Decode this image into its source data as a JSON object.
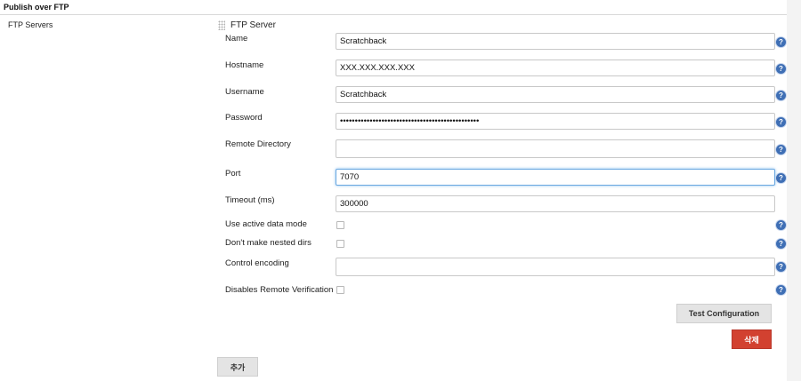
{
  "section": {
    "title": "Publish over FTP",
    "side_label": "FTP Servers"
  },
  "server": {
    "title": "FTP Server",
    "fields": {
      "name": {
        "label": "Name",
        "value": "Scratchback"
      },
      "hostname": {
        "label": "Hostname",
        "value": "XXX.XXX.XXX.XXX"
      },
      "username": {
        "label": "Username",
        "value": "Scratchback"
      },
      "password": {
        "label": "Password",
        "value": "•••••••••••••••••••••••••••••••••••••••••••••••"
      },
      "remote_directory": {
        "label": "Remote Directory",
        "value": ""
      },
      "port": {
        "label": "Port",
        "value": "7070"
      },
      "timeout": {
        "label": "Timeout (ms)",
        "value": "300000"
      },
      "active_mode": {
        "label": "Use active data mode",
        "checked": false
      },
      "nested_dirs": {
        "label": "Don't make nested dirs",
        "checked": false
      },
      "control_encoding": {
        "label": "Control encoding",
        "value": ""
      },
      "remote_verification": {
        "label": "Disables Remote Verification",
        "checked": false
      }
    },
    "help_glyph": "?"
  },
  "buttons": {
    "test": "Test Configuration",
    "delete": "삭제",
    "add": "추가"
  },
  "icons": {
    "grip": "drag-handle-icon",
    "help": "help-icon"
  },
  "colors": {
    "delete_button": "#d24130",
    "help_icon": "#3f6fb5",
    "focus_border": "#6aa8e0"
  }
}
